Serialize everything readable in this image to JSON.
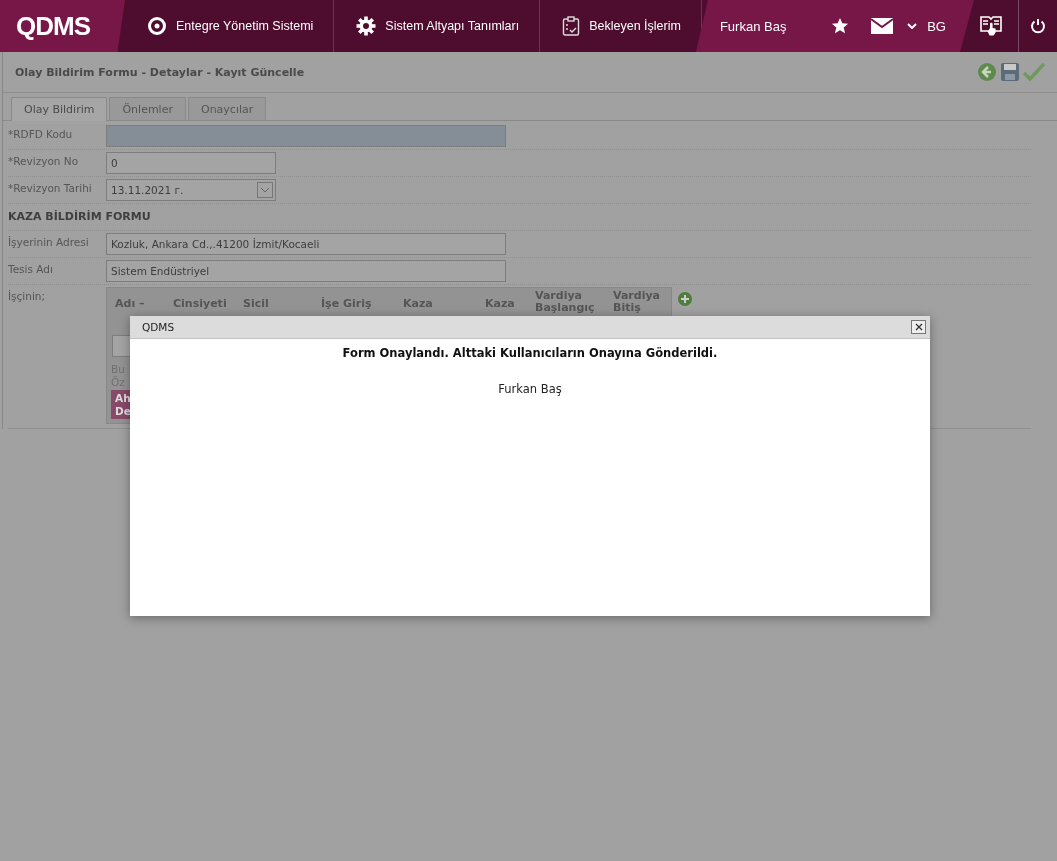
{
  "header": {
    "logo": "QDMS",
    "nav": [
      {
        "label": "Entegre Yönetim Sistemi"
      },
      {
        "label": "Sistem Altyapı Tanımları"
      },
      {
        "label": "Bekleyen İşlerim"
      }
    ],
    "user": "Furkan Baş",
    "language": "BG"
  },
  "page_title": "Olay Bildirim Formu - Detaylar - Kayıt Güncelle",
  "tabs": [
    {
      "label": "Olay Bildirim",
      "selected": true
    },
    {
      "label": "Önlemler",
      "selected": false
    },
    {
      "label": "Onaycılar",
      "selected": false
    }
  ],
  "fields": [
    {
      "label": "*RDFD Kodu",
      "kind": "readonly"
    },
    {
      "label": "*Revizyon No",
      "kind": "text",
      "value": "0"
    },
    {
      "label": "*Revizyon Tarihi",
      "kind": "date",
      "value": "13.11.2021 г."
    }
  ],
  "section_title": "KAZA BİLDİRİM FORMU",
  "fields2": [
    {
      "label": "İşyerinin Adresi",
      "kind": "wide",
      "value": "Kozluk, Ankara Cd.,.41200 İzmit/Kocaeli"
    },
    {
      "label": "Tesis Adı",
      "kind": "wide",
      "value": "Sistem Endüstriyel"
    }
  ],
  "workers": {
    "label": "İşçinin;",
    "columns": [
      "Adı –",
      "Cinsiyeti",
      "Sicil",
      "İşe Giriş",
      "Kaza",
      "Kaza",
      "Vardiya Başlangıç",
      "Vardiya Bitiş"
    ],
    "notes": [
      "Bu",
      "Öz"
    ],
    "button": "Ah De"
  },
  "dialog": {
    "title": "QDMS",
    "message": "Form Onaylandı. Alttaki Kullanıcıların Onayına Gönderildi.",
    "users": [
      "Furkan Baş"
    ]
  }
}
